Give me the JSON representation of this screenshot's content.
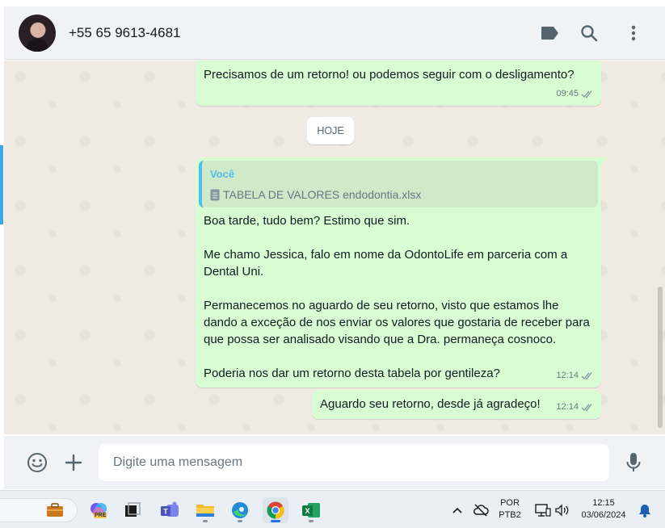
{
  "header": {
    "contact_name": "+55 65 9613-4681",
    "icons": [
      "label-icon",
      "search-icon",
      "menu-icon"
    ]
  },
  "chat": {
    "messages": [
      {
        "text": "Precisamos de um retorno! ou podemos seguir com o desligamento?",
        "time": "09:45",
        "status": "read"
      },
      {
        "quote_author": "Você",
        "quote_file": "TABELA DE VALORES endodontia.xlsx",
        "text": "Boa tarde, tudo bem? Estimo que sim.\n\nMe chamo Jessica, falo em nome da OdontoLife em parceria com a Dental Uni.\n\nPermanecemos no aguardo de seu retorno, visto que estamos lhe dando a exceção de nos enviar os valores que gostaria de receber para que possa ser analisado visando que a Dra. permaneça cosnoco.\n\nPoderia nos dar um retorno desta tabela por gentileza?",
        "time": "12:14",
        "status": "read"
      },
      {
        "text": "Aguardo seu retorno, desde já agradeço!",
        "time": "12:14",
        "status": "read"
      }
    ],
    "date_divider": "HOJE"
  },
  "composer": {
    "placeholder": "Digite uma mensagem",
    "icons": [
      "emoji-icon",
      "plus-icon",
      "microphone-icon"
    ]
  },
  "taskbar": {
    "apps": [
      "work-icon",
      "copilot-icon",
      "taskview-icon",
      "teams-icon",
      "file-explorer-icon",
      "edge-icon",
      "chrome-icon",
      "excel-icon"
    ],
    "copilot_badge": "PRE",
    "lang_top": "POR",
    "lang_bottom": "PTB2",
    "time": "12:15",
    "date": "03/06/2024"
  },
  "colors": {
    "outgoing_bubble": "#d9fdd3",
    "chat_background": "#efeae2",
    "read_ticks": "#53bdeb",
    "header_bg": "#f0f2f5"
  }
}
